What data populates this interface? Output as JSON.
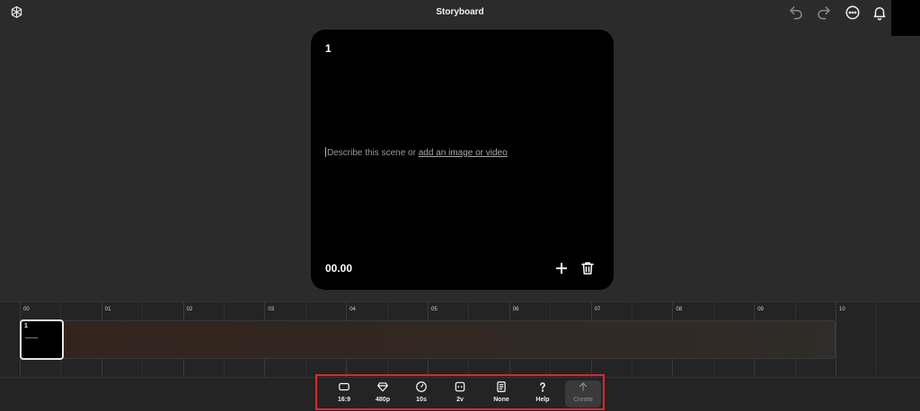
{
  "header": {
    "title": "Storyboard",
    "icons": [
      "openai-logo-icon",
      "undo-icon",
      "redo-icon",
      "more-options-icon",
      "notifications-bell-icon"
    ]
  },
  "scene": {
    "number": "1",
    "prompt_text": "Describe this scene or ",
    "prompt_link": "add an image or video",
    "timestamp": "00.00",
    "icons": [
      "add-icon",
      "trash-icon"
    ]
  },
  "timeline": {
    "ticks": [
      "00",
      "01",
      "02",
      "03",
      "04",
      "05",
      "06",
      "07",
      "08",
      "09",
      "10"
    ],
    "clip": {
      "number": "1"
    }
  },
  "toolbar": {
    "items": [
      {
        "label": "16:9",
        "icon": "aspect-ratio-icon"
      },
      {
        "label": "480p",
        "icon": "resolution-diamond-icon"
      },
      {
        "label": "10s",
        "icon": "duration-clock-icon"
      },
      {
        "label": "2v",
        "icon": "variations-icon"
      },
      {
        "label": "None",
        "icon": "preset-icon"
      },
      {
        "label": "Help",
        "icon": "help-icon"
      },
      {
        "label": "Create",
        "icon": "create-arrow-icon"
      }
    ]
  },
  "colors": {
    "highlight": "#e3242b",
    "background": "#2b2b2b",
    "card": "#000000"
  }
}
